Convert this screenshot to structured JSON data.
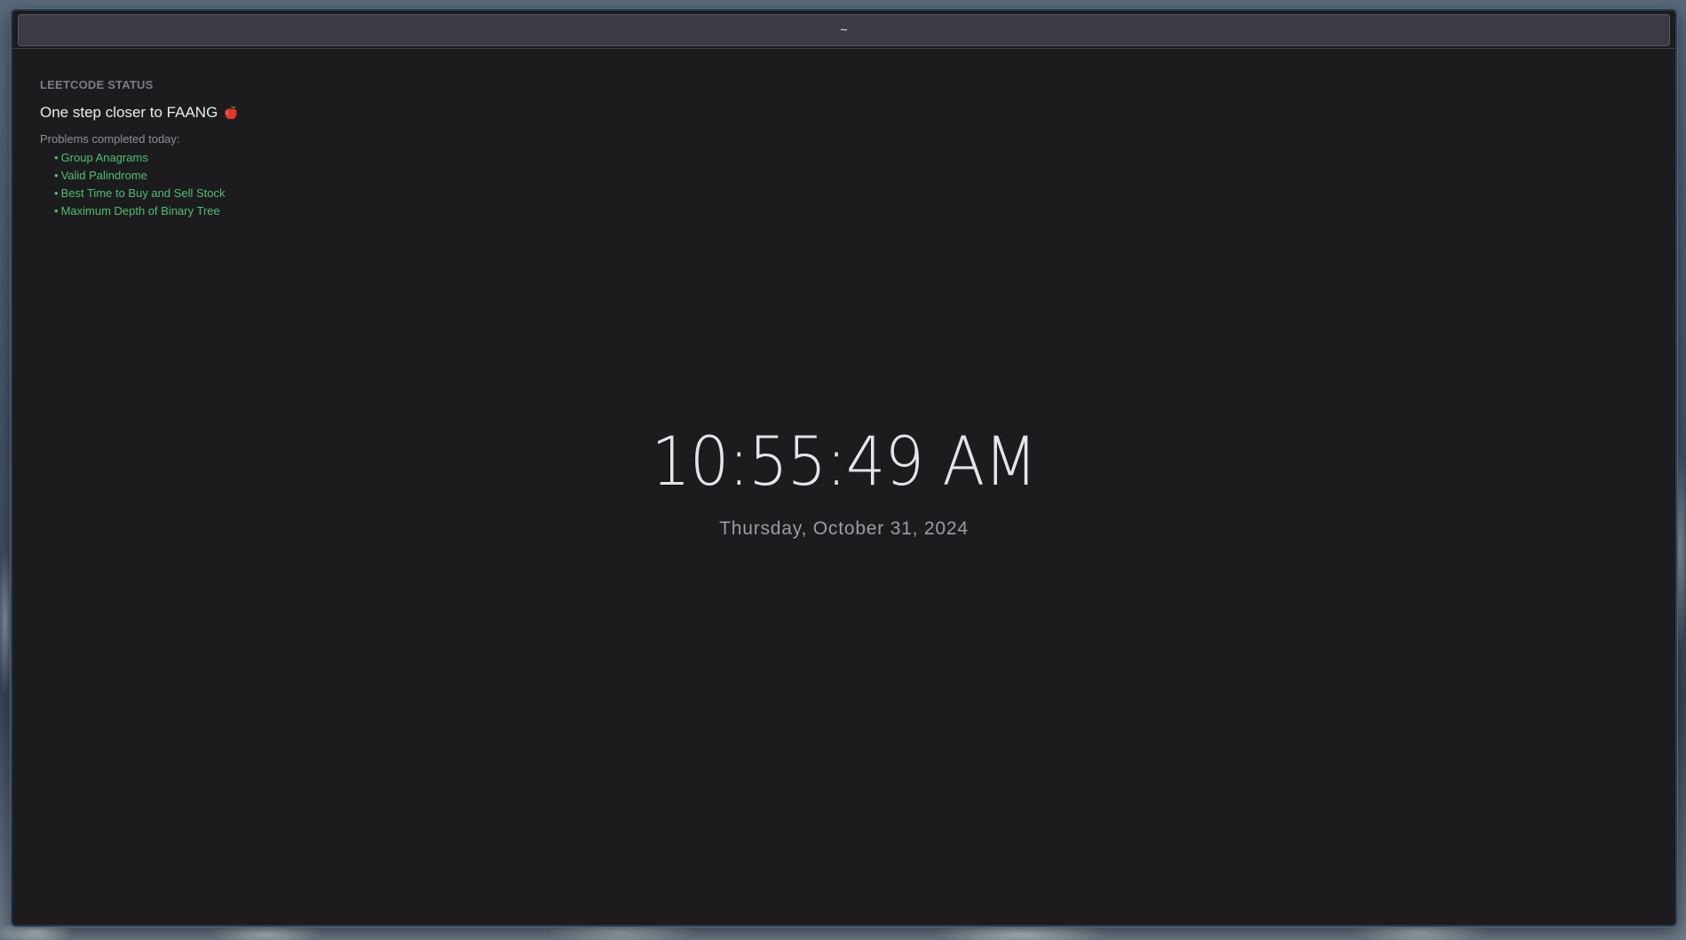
{
  "window": {
    "title": "~"
  },
  "status": {
    "label": "LEETCODE STATUS",
    "headline": "One step closer to FAANG",
    "headline_icon": "apple-icon",
    "problems_label": "Problems completed today:",
    "problems": [
      "Group Anagrams",
      "Valid Palindrome",
      "Best Time to Buy and Sell Stock",
      "Maximum Depth of Binary Tree"
    ],
    "bullet": "•"
  },
  "clock": {
    "time": "10:55:49 AM",
    "date": "Thursday, October 31, 2024"
  },
  "colors": {
    "background": "#1c1c1f",
    "title_bar": "#3b3a45",
    "accent_green": "#4fbf6b",
    "text_primary": "#ececf0",
    "text_muted": "#7b7b85"
  }
}
